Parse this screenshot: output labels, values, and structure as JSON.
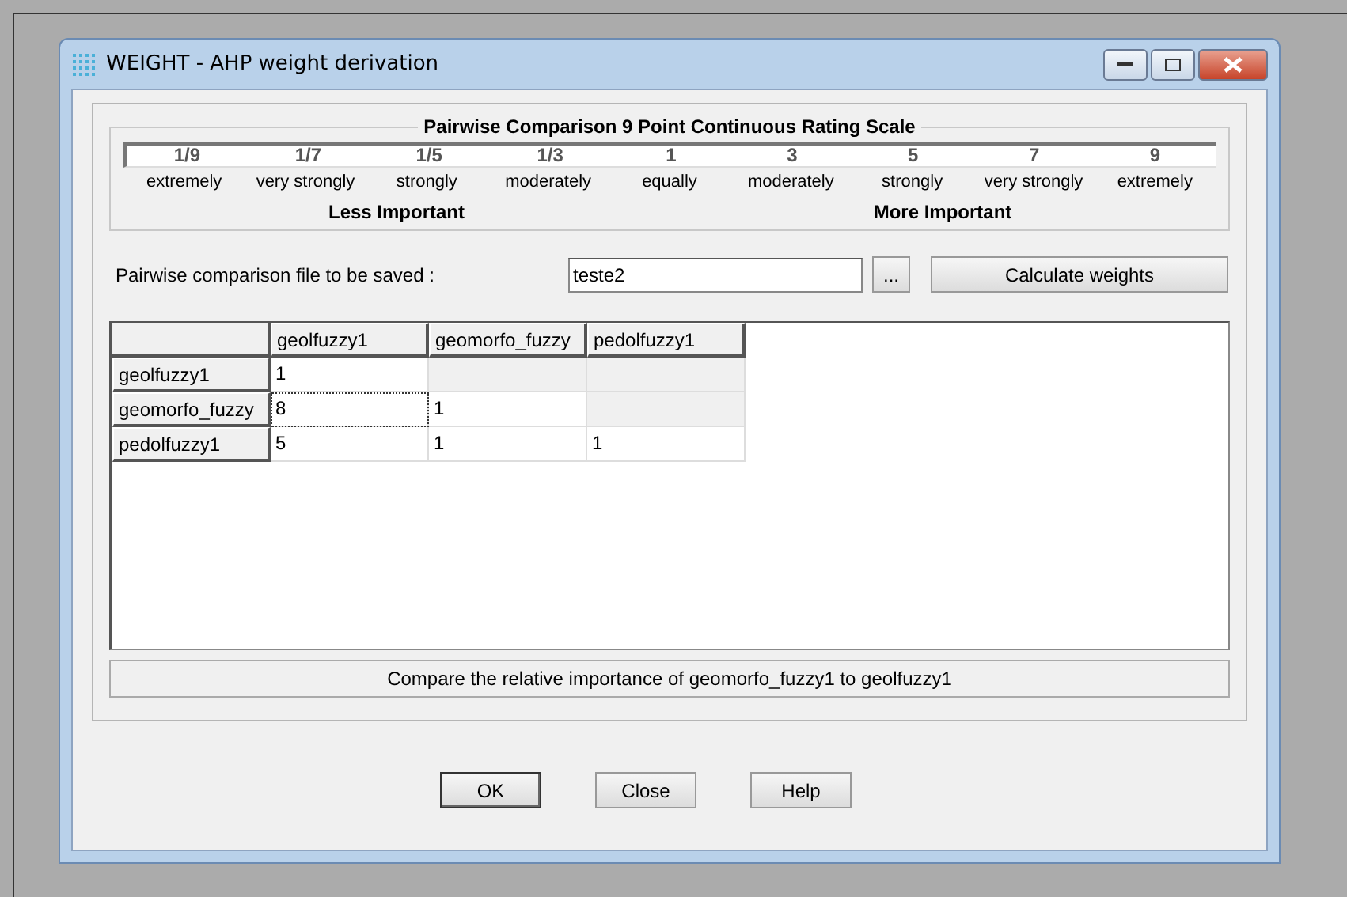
{
  "window": {
    "title": "WEIGHT - AHP weight derivation"
  },
  "scale": {
    "title": "Pairwise Comparison 9 Point Continuous Rating Scale",
    "points": [
      {
        "value": "1/9",
        "label": "extremely"
      },
      {
        "value": "1/7",
        "label": "very strongly"
      },
      {
        "value": "1/5",
        "label": "strongly"
      },
      {
        "value": "1/3",
        "label": "moderately"
      },
      {
        "value": "1",
        "label": "equally"
      },
      {
        "value": "3",
        "label": "moderately"
      },
      {
        "value": "5",
        "label": "strongly"
      },
      {
        "value": "7",
        "label": "very strongly"
      },
      {
        "value": "9",
        "label": "extremely"
      }
    ],
    "left_caption": "Less Important",
    "right_caption": "More Important"
  },
  "file": {
    "label": "Pairwise comparison file to be saved :",
    "value": "teste2",
    "browse": "...",
    "calculate": "Calculate weights"
  },
  "grid": {
    "columns": [
      "geolfuzzy1",
      "geomorfo_fuzzy",
      "pedolfuzzy1"
    ],
    "rows": [
      {
        "header": "geolfuzzy1",
        "cells": [
          {
            "value": "1",
            "editable": true,
            "focused": false
          },
          {
            "editable": false,
            "focused": false
          },
          {
            "editable": false,
            "focused": false
          }
        ]
      },
      {
        "header": "geomorfo_fuzzy",
        "cells": [
          {
            "value": "8",
            "editable": true,
            "focused": true
          },
          {
            "value": "1",
            "editable": true,
            "focused": false
          },
          {
            "editable": false,
            "focused": false
          }
        ]
      },
      {
        "header": "pedolfuzzy1",
        "cells": [
          {
            "value": "5",
            "editable": true,
            "focused": false
          },
          {
            "value": "1",
            "editable": true,
            "focused": false
          },
          {
            "value": "1",
            "editable": true,
            "focused": false
          }
        ]
      }
    ]
  },
  "status": "Compare the relative importance of geomorfo_fuzzy1 to geolfuzzy1",
  "buttons": [
    {
      "label": "OK",
      "default": true
    },
    {
      "label": "Close",
      "default": false
    },
    {
      "label": "Help",
      "default": false
    }
  ]
}
